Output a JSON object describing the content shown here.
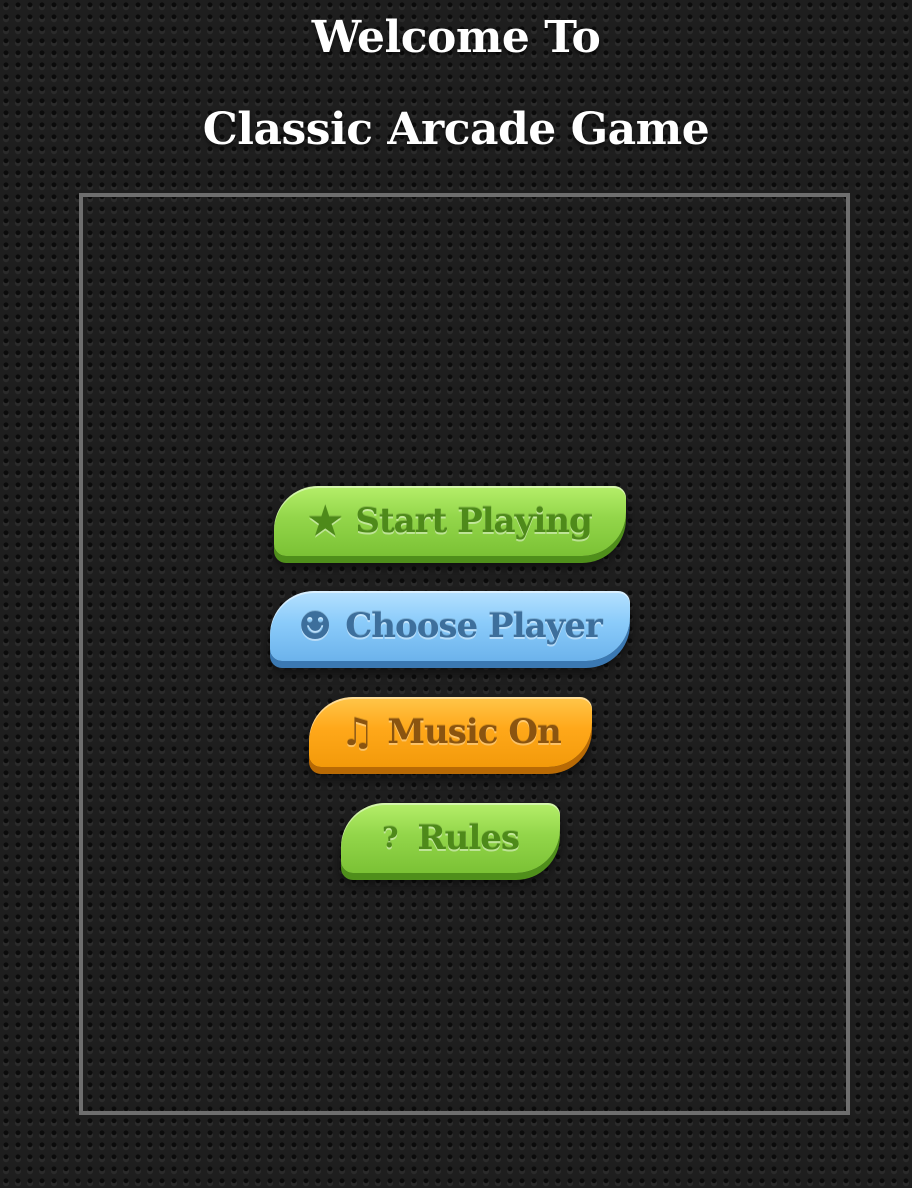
{
  "title": {
    "line1": "Welcome To",
    "line2": "Classic Arcade Game"
  },
  "menu": [
    {
      "label": "Start Playing",
      "icon": "star-icon",
      "glyph": "★",
      "color": "#93d64a"
    },
    {
      "label": "Choose Player",
      "icon": "smiley-icon",
      "glyph": "☻",
      "color": "#8acbfa"
    },
    {
      "label": "Music On",
      "icon": "music-note-icon",
      "glyph": "♫",
      "color": "#ffa81a"
    },
    {
      "label": "Rules",
      "icon": "question-icon",
      "glyph": "?",
      "color": "#93d64a"
    }
  ]
}
